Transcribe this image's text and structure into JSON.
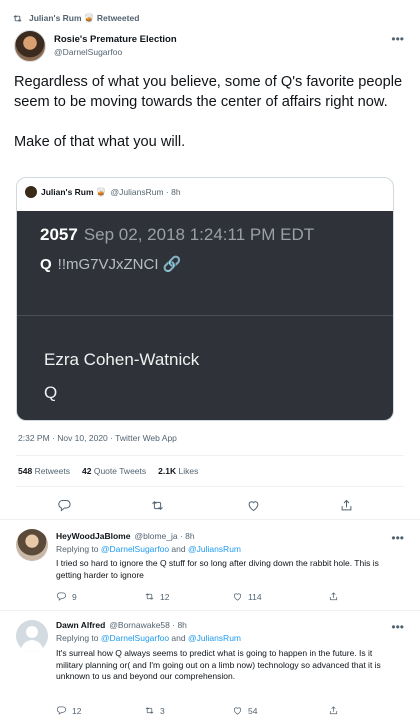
{
  "retweet": {
    "label": "Julian's Rum 🥃 Retweeted"
  },
  "tweet": {
    "display_name": "Rosie's Premature Election",
    "handle": "@DarnelSugarfoo",
    "text": "Regardless of what you believe, some of Q's favorite people seem to be moving towards the center of affairs right now.\n\nMake of that what you will.",
    "more_icon": "•••",
    "timestamp": "2:32 PM · Nov 10, 2020 · Twitter Web App",
    "stats": {
      "retweets_count": "548",
      "retweets_label": "Retweets",
      "quotes_count": "42",
      "quotes_label": "Quote Tweets",
      "likes_count": "2.1K",
      "likes_label": "Likes"
    }
  },
  "quote": {
    "name": "Julian's Rum 🥃",
    "handle_time": "@JuliansRum · 8h",
    "image": {
      "post_number": "2057",
      "post_date": "Sep 02, 2018 1:24:11 PM EDT",
      "q_label": "Q",
      "tripcode": "!!mG7VJxZNCI",
      "name_line": "Ezra Cohen-Watnick",
      "sig_line": "Q"
    }
  },
  "replies": [
    {
      "name": "HeyWoodJaBlome",
      "handle_time": "@blome_ja · 8h",
      "replying_prefix": "Replying to ",
      "mention1": "@DarnelSugarfoo",
      "and": " and ",
      "mention2": "@JuliansRum",
      "text": "I tried so hard to ignore the Q stuff for so long after diving down the rabbit hole. This is getting harder to ignore",
      "reply_count": "9",
      "retweet_count": "12",
      "like_count": "114"
    },
    {
      "name": "Dawn Alfred",
      "handle_time": "@Bornawake58 · 8h",
      "replying_prefix": "Replying to ",
      "mention1": "@DarnelSugarfoo",
      "and": " and ",
      "mention2": "@JuliansRum",
      "text": "It's surreal how Q always seems to predict what is going to happen in the future. Is it military planning or( and I'm going out on a limb now) technology so advanced that it is unknown to us and beyond our comprehension.",
      "reply_count": "12",
      "retweet_count": "3",
      "like_count": "54"
    }
  ],
  "icons": {
    "retweet": "retweet-icon",
    "reply": "reply-icon",
    "like": "heart-icon",
    "share": "share-icon",
    "link": "link-icon",
    "more": "more-icon"
  },
  "colors": {
    "accent": "#1d9bf0",
    "secondary_text": "#536471",
    "quote_image_bg": "#2f3339"
  }
}
